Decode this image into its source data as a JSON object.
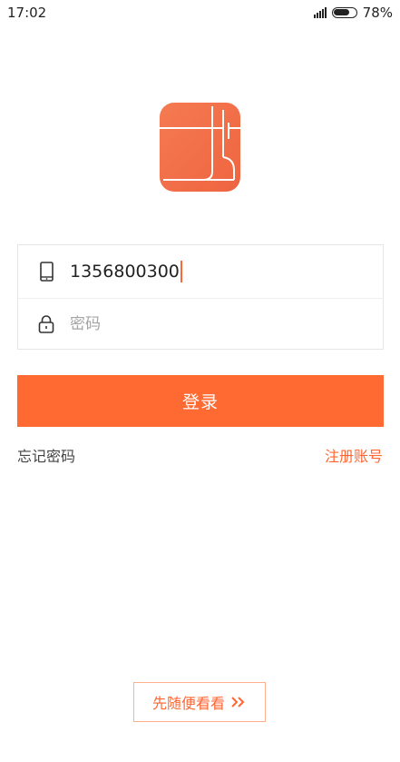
{
  "status_bar": {
    "time": "17:02",
    "battery_text": "78%",
    "battery_level": 0.78
  },
  "login_form": {
    "phone_value": "1356800300",
    "password_placeholder": "密码",
    "phone_icon": "phone-icon",
    "lock_icon": "lock-icon"
  },
  "actions": {
    "login_label": "登录",
    "forgot_password_label": "忘记密码",
    "register_label": "注册账号",
    "browse_label": "先随便看看"
  },
  "colors": {
    "accent": "#ff6a33",
    "logo": "#f26b46"
  }
}
